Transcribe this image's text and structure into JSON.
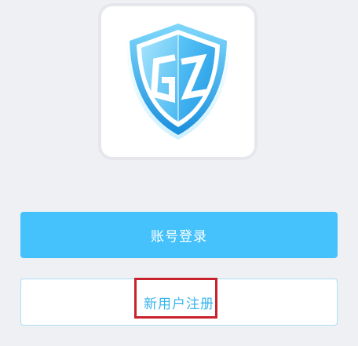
{
  "app": {
    "logo_text": "GZ"
  },
  "buttons": {
    "login_label": "账号登录",
    "register_label": "新用户注册"
  },
  "colors": {
    "background": "#eff0f4",
    "primary": "#45c2fb",
    "register_text": "#37b5ee",
    "highlight": "#c8232c"
  }
}
